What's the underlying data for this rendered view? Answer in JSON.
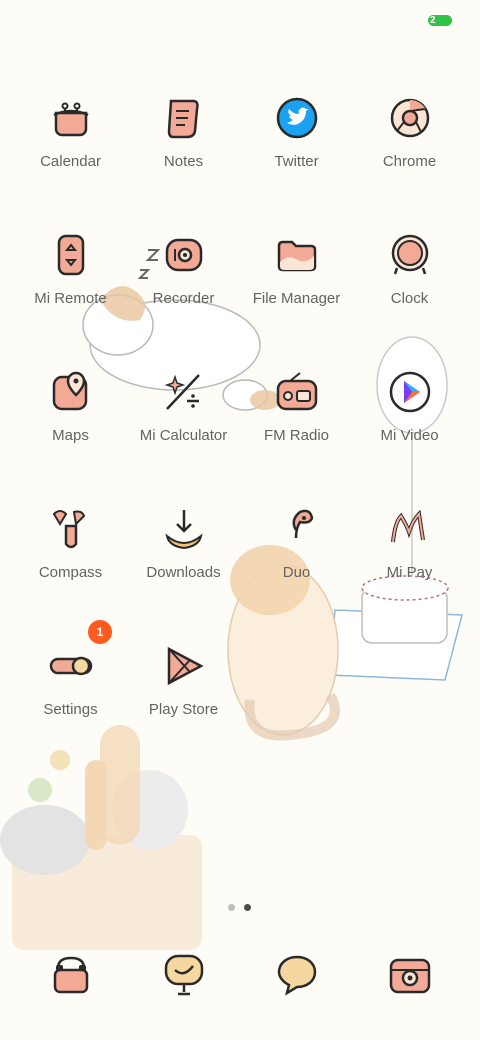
{
  "status_bar": {
    "time": "",
    "indicators": "",
    "battery": "2"
  },
  "home": {
    "apps": [
      {
        "name": "Calendar",
        "icon": "calendar-icon"
      },
      {
        "name": "Notes",
        "icon": "notes-icon"
      },
      {
        "name": "Twitter",
        "icon": "twitter-icon"
      },
      {
        "name": "Chrome",
        "icon": "chrome-icon"
      },
      {
        "name": "Mi Remote",
        "icon": "remote-icon"
      },
      {
        "name": "Recorder",
        "icon": "recorder-icon"
      },
      {
        "name": "File Manager",
        "icon": "folder-icon"
      },
      {
        "name": "Clock",
        "icon": "clock-icon"
      },
      {
        "name": "Maps",
        "icon": "map-pin-icon"
      },
      {
        "name": "Mi Calculator",
        "icon": "calculator-icon"
      },
      {
        "name": "FM Radio",
        "icon": "radio-icon"
      },
      {
        "name": "Mi Video",
        "icon": "video-play-icon"
      },
      {
        "name": "Compass",
        "icon": "compass-icon"
      },
      {
        "name": "Downloads",
        "icon": "download-icon"
      },
      {
        "name": "Duo",
        "icon": "duo-icon"
      },
      {
        "name": "Mi Pay",
        "icon": "mi-pay-icon"
      },
      {
        "name": "Settings",
        "icon": "settings-toggle-icon"
      },
      {
        "name": "Play Store",
        "icon": "play-store-icon"
      }
    ],
    "settings_badge": "1",
    "page_indicator": {
      "pages": 2,
      "current": 2
    }
  },
  "dock": [
    {
      "icon": "phone-icon"
    },
    {
      "icon": "messages-icon"
    },
    {
      "icon": "chat-bubble-icon"
    },
    {
      "icon": "camera-icon"
    }
  ],
  "colors": {
    "background": "#fdfcf6",
    "icon_fill": "#f2a995",
    "outline": "#2a2a2a",
    "badge": "#ff5a1f",
    "twitter": "#1da1f2"
  }
}
